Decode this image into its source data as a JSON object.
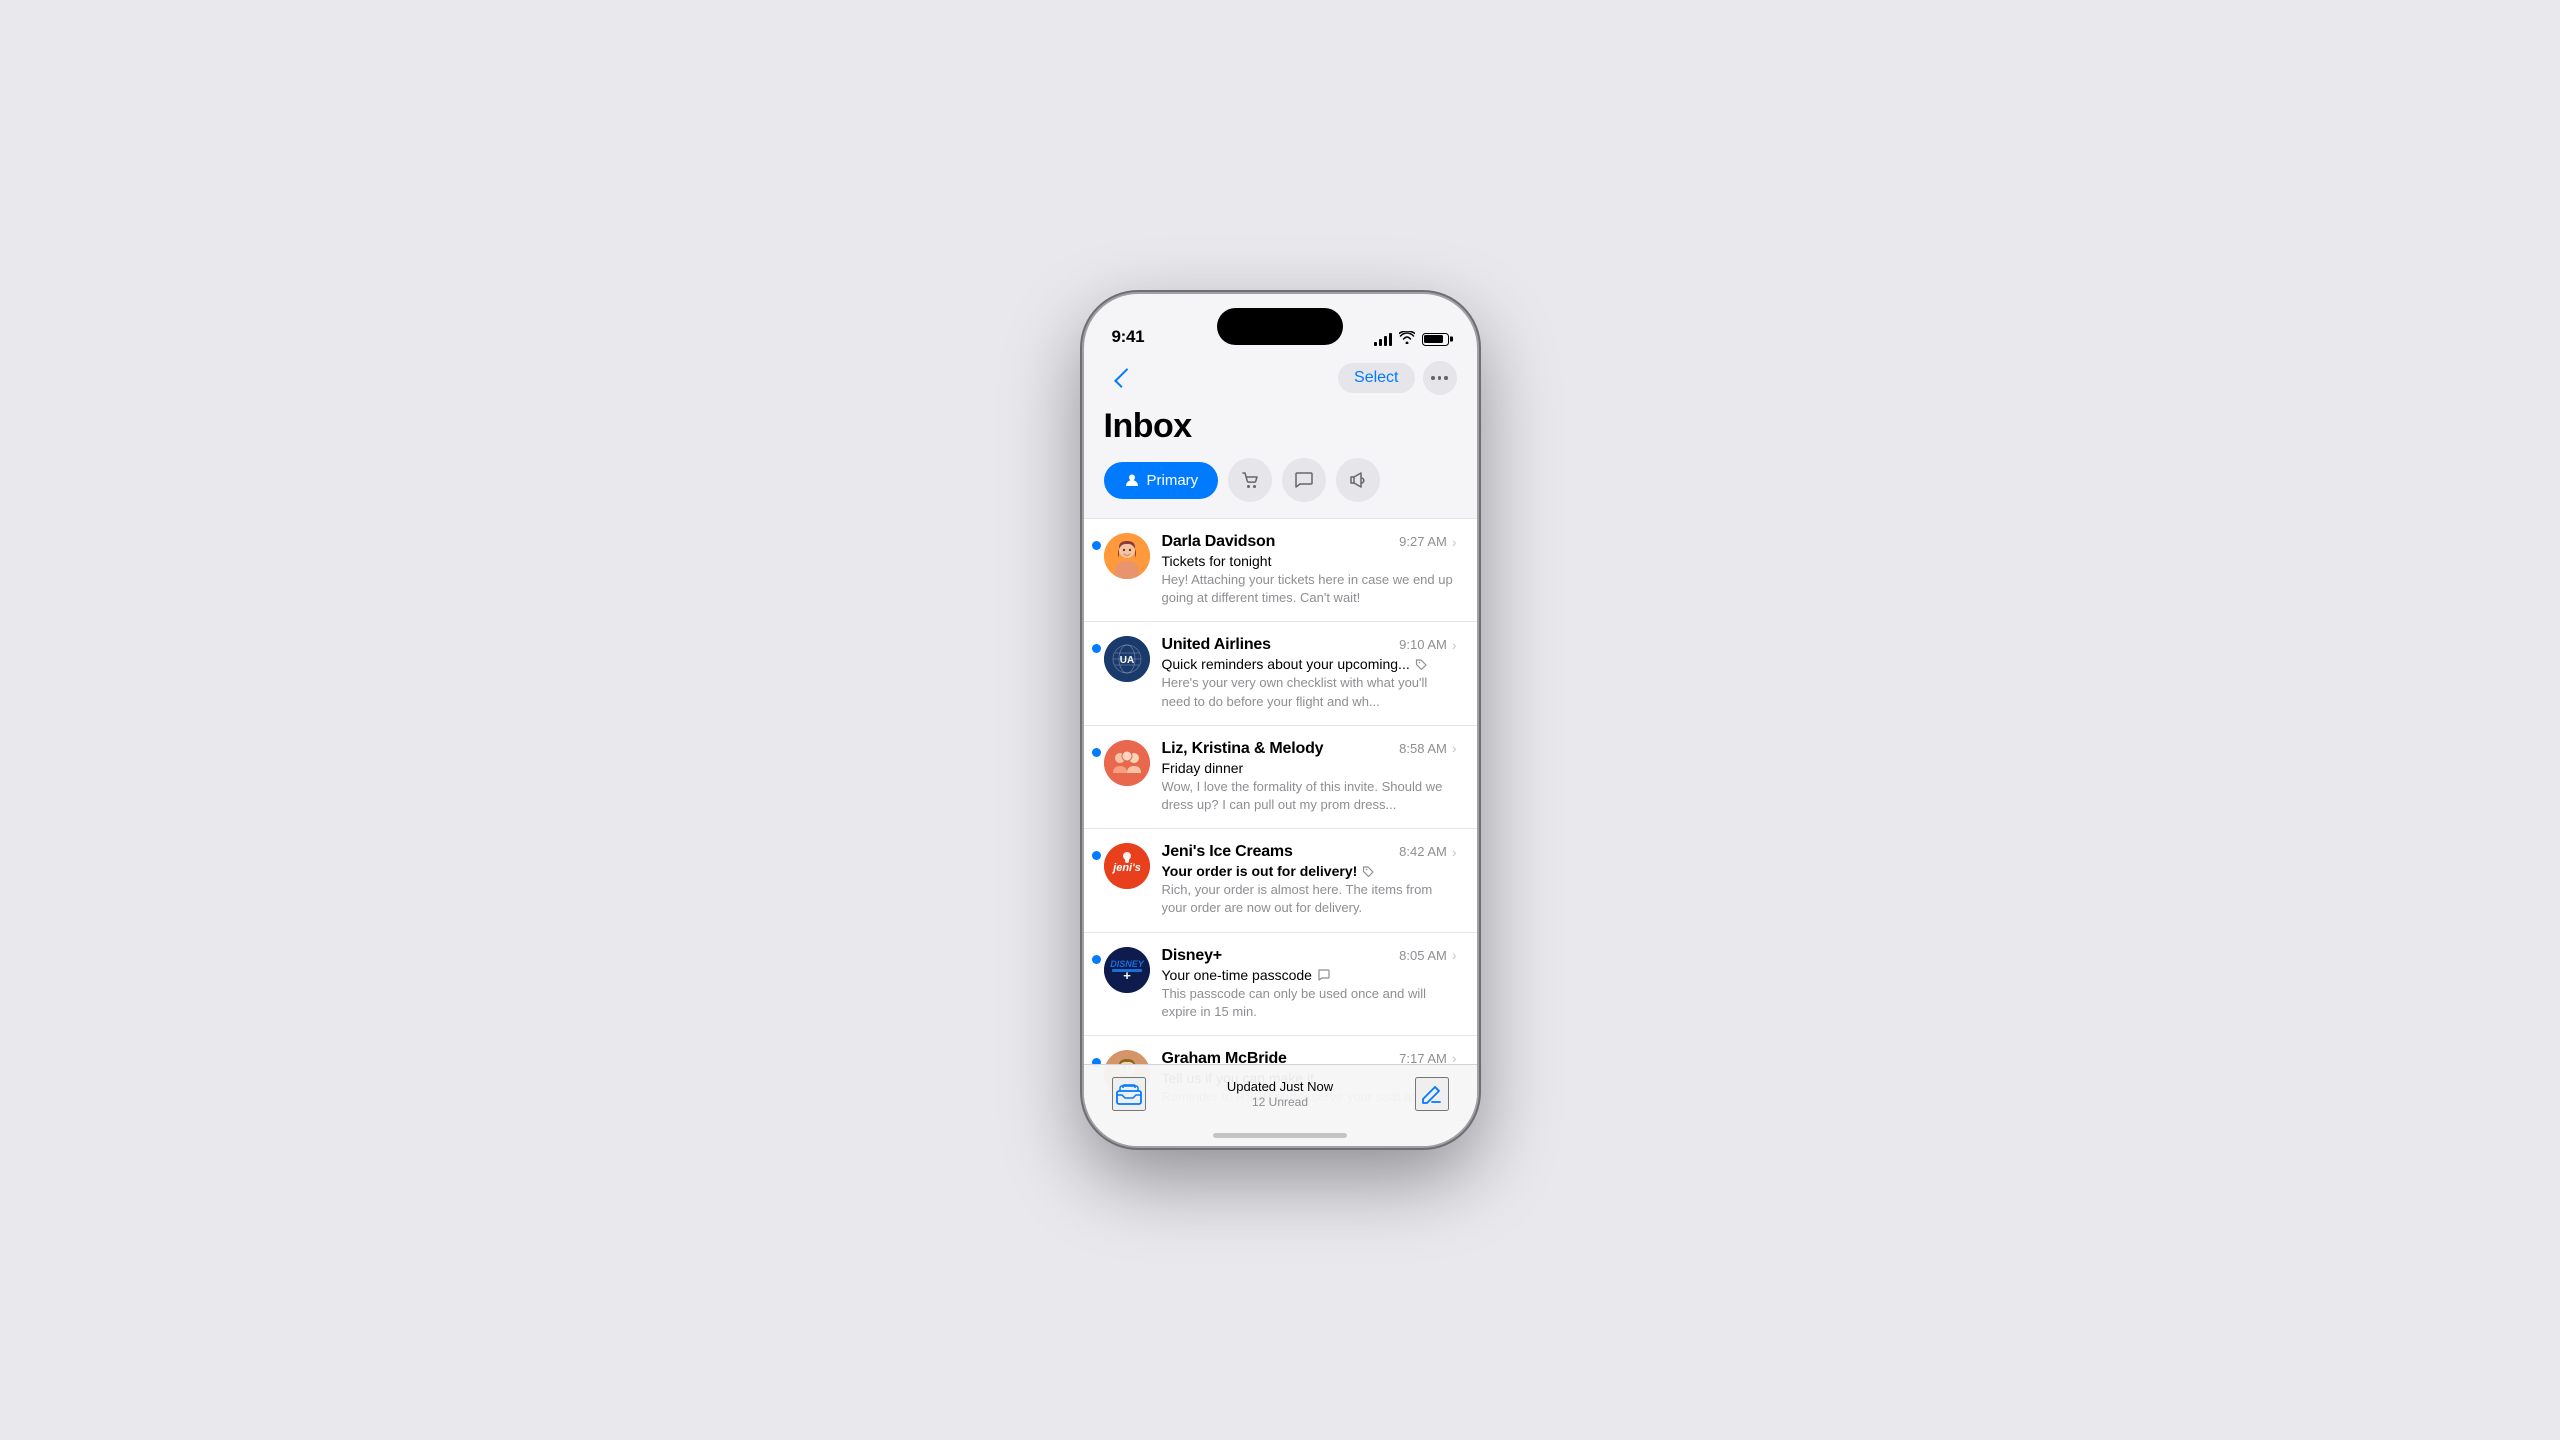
{
  "phone": {
    "time": "9:41",
    "dynamic_island": true
  },
  "nav": {
    "back_label": "",
    "select_label": "Select",
    "more_label": "..."
  },
  "inbox": {
    "title": "Inbox"
  },
  "tabs": [
    {
      "id": "primary",
      "label": "Primary",
      "icon": "person",
      "active": true
    },
    {
      "id": "shopping",
      "label": "Shopping",
      "icon": "cart",
      "active": false
    },
    {
      "id": "social",
      "label": "Social",
      "icon": "bubble",
      "active": false
    },
    {
      "id": "updates",
      "label": "Updates",
      "icon": "megaphone",
      "active": false
    }
  ],
  "emails": [
    {
      "id": 1,
      "sender": "Darla Davidson",
      "subject": "Tickets for tonight",
      "preview": "Hey! Attaching your tickets here in case we end up going at different times. Can't wait!",
      "time": "9:27 AM",
      "unread": true,
      "avatar_type": "darla",
      "avatar_emoji": "🧑‍🦰",
      "category_icon": null
    },
    {
      "id": 2,
      "sender": "United Airlines",
      "subject": "Quick reminders about your upcoming...",
      "preview": "Here's your very own checklist with what you'll need to do before your flight and wh...",
      "time": "9:10 AM",
      "unread": true,
      "avatar_type": "united",
      "avatar_emoji": "🌐",
      "category_icon": "cart"
    },
    {
      "id": 3,
      "sender": "Liz, Kristina & Melody",
      "subject": "Friday dinner",
      "preview": "Wow, I love the formality of this invite. Should we dress up? I can pull out my prom dress...",
      "time": "8:58 AM",
      "unread": true,
      "avatar_type": "group",
      "avatar_emoji": "👥",
      "category_icon": null
    },
    {
      "id": 4,
      "sender": "Jeni's Ice Creams",
      "subject": "Your order is out for delivery!",
      "preview": "Rich, your order is almost here. The items from your order are now out for delivery.",
      "time": "8:42 AM",
      "unread": true,
      "avatar_type": "jenis",
      "avatar_emoji": "🍦",
      "category_icon": "cart"
    },
    {
      "id": 5,
      "sender": "Disney+",
      "subject": "Your one-time passcode",
      "preview": "This passcode can only be used once and will expire in 15 min.",
      "time": "8:05 AM",
      "unread": true,
      "avatar_type": "disney",
      "avatar_emoji": "⭐",
      "category_icon": "bubble"
    },
    {
      "id": 6,
      "sender": "Graham McBride",
      "subject": "Tell us if you can make it",
      "preview": "Reminder to RSVP and reserve your seat at",
      "time": "7:17 AM",
      "unread": true,
      "avatar_type": "graham",
      "avatar_emoji": "👨",
      "category_icon": null
    }
  ],
  "bottom_bar": {
    "status": "Updated Just Now",
    "unread_count": "12 Unread"
  }
}
